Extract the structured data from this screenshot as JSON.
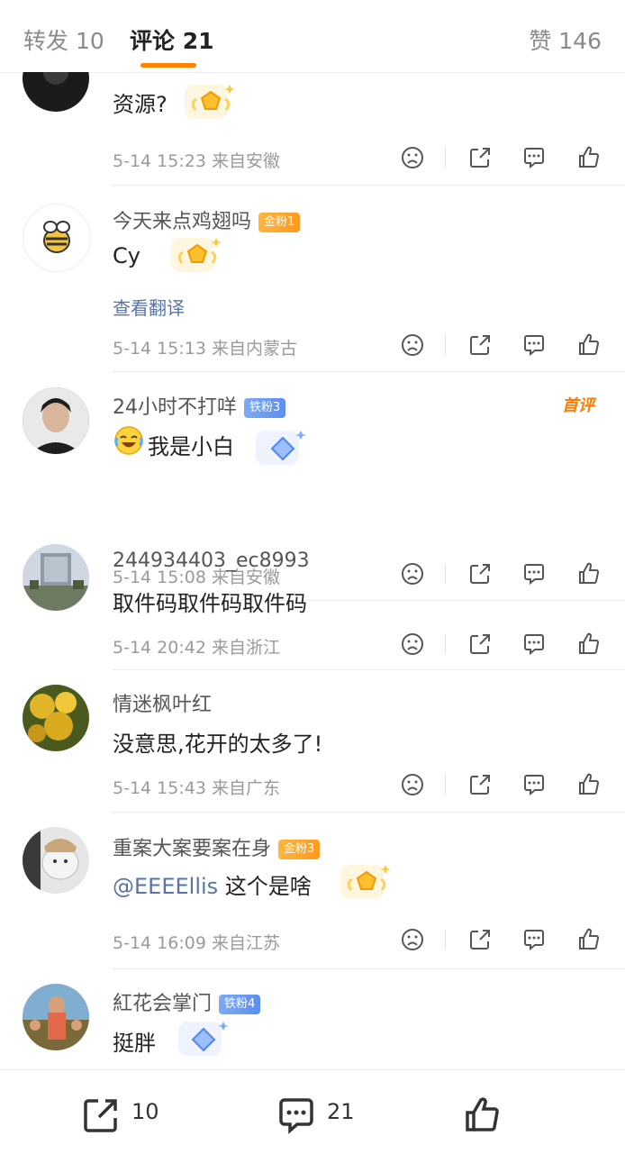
{
  "tabs": {
    "repost": "转发 10",
    "comment": "评论 21",
    "like": "赞 146"
  },
  "comments": [
    {
      "text": "资源?",
      "meta": "5-14 15:23 来自安徽"
    },
    {
      "user": "今天来点鸡翅吗",
      "badge": "金粉1",
      "text": "Cy",
      "translate": "查看翻译",
      "meta": "5-14 15:13 来自内蒙古"
    },
    {
      "user": "24小时不打咩",
      "badge": "铁粉3",
      "first_tag": "首评",
      "text": "我是小白",
      "meta": "5-14 15:08 来自安徽"
    },
    {
      "user": "244934403_ec8993",
      "text": "取件码取件码取件码",
      "meta": "5-14 20:42 来自浙江"
    },
    {
      "user": "情迷枫叶红",
      "text": "没意思,花开的太多了!",
      "meta": "5-14 15:43 来自广东"
    },
    {
      "user": "重案大案要案在身",
      "badge": "金粉3",
      "mention": "@EEEEllis",
      "text": "这个是啥",
      "meta": "5-14 16:09 来自江苏"
    },
    {
      "user": "紅花会掌门",
      "badge": "铁粉4",
      "text": "挺胖"
    }
  ],
  "bottom_bar": {
    "repost_count": "10",
    "comment_count": "21"
  },
  "colors": {
    "accent": "#ff8200",
    "link": "#5774a8",
    "gold_badge": "#ffa72c",
    "iron_badge": "#6b9af2"
  },
  "icons": [
    "sad-face-icon",
    "share-icon",
    "comment-bubble-icon",
    "thumbs-up-icon"
  ]
}
